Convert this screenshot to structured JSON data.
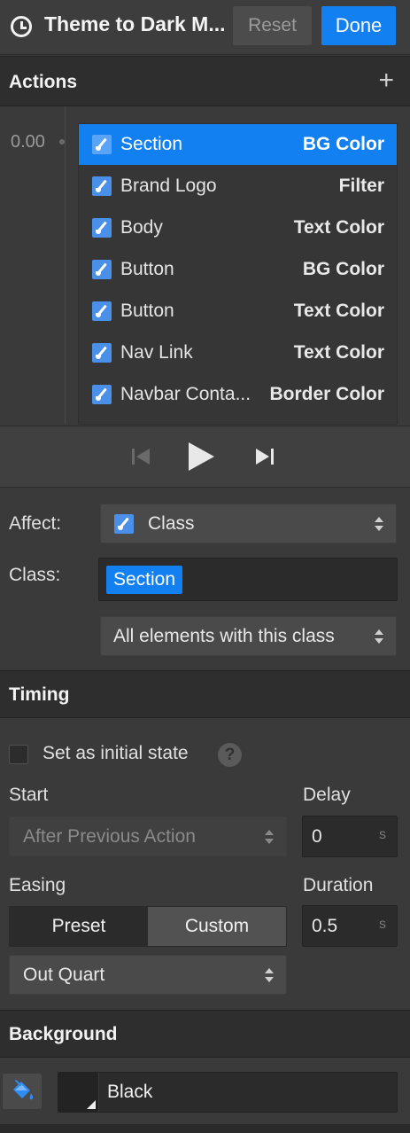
{
  "header": {
    "title": "Theme to Dark M...",
    "reset_label": "Reset",
    "done_label": "Done"
  },
  "actions": {
    "heading": "Actions",
    "add_icon": "plus-icon",
    "time_marker": "0.00",
    "items": [
      {
        "name": "Section",
        "property": "BG Color",
        "selected": true
      },
      {
        "name": "Brand Logo",
        "property": "Filter",
        "selected": false
      },
      {
        "name": "Body",
        "property": "Text Color",
        "selected": false
      },
      {
        "name": "Button",
        "property": "BG Color",
        "selected": false
      },
      {
        "name": "Button",
        "property": "Text Color",
        "selected": false
      },
      {
        "name": "Nav Link",
        "property": "Text Color",
        "selected": false
      },
      {
        "name": "Navbar Conta...",
        "property": "Border Color",
        "selected": false
      }
    ]
  },
  "playback": {
    "prev_icon": "skip-back-icon",
    "play_icon": "play-icon",
    "next_icon": "skip-forward-icon"
  },
  "target": {
    "affect_label": "Affect:",
    "affect_value": "Class",
    "class_label": "Class:",
    "class_chip": "Section",
    "scope_value": "All elements with this class"
  },
  "timing": {
    "heading": "Timing",
    "initial_state_label": "Set as initial state",
    "initial_state_checked": false,
    "help_glyph": "?",
    "start_label": "Start",
    "start_value": "After Previous Action",
    "delay_label": "Delay",
    "delay_value": "0",
    "delay_unit": "s",
    "easing_label": "Easing",
    "preset_label": "Preset",
    "custom_label": "Custom",
    "easing_mode_selected": "Preset",
    "easing_value": "Out Quart",
    "duration_label": "Duration",
    "duration_value": "0.5",
    "duration_unit": "s"
  },
  "background": {
    "heading": "Background",
    "paint_icon": "paint-bucket-icon",
    "color_name": "Black"
  },
  "colors": {
    "accent": "#1280f0",
    "panel": "#3a3a3a",
    "section_header": "#2e2e2e",
    "field": "#2b2b2b"
  }
}
